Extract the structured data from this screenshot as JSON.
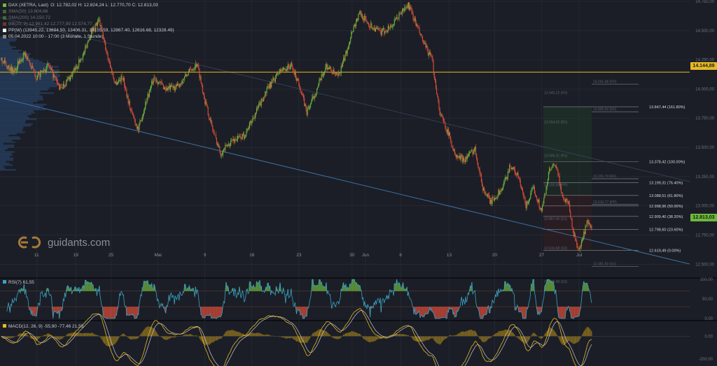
{
  "instrument": {
    "title": "DAX (XETRA, Last)",
    "ohlc": "O: 12.782,02  H: 12.824,24  L: 12.770,70  C: 12.813,03"
  },
  "indicators": [
    {
      "label": "SMA(50)  13.604,66",
      "color": "#6fb83f",
      "dim": true
    },
    {
      "label": "SMA(200)  14.150,72",
      "color": "#6fb83f",
      "dim": true
    },
    {
      "label": "BB(20, 2)  12.981,42  12.777,99  12.574,77",
      "color": "#e04e3b",
      "dim": true
    },
    {
      "label": "PP(W)  (13945.22, 13694.50, 13406.31, 13155.59, 12867.40, 12616.68, 12328.49)",
      "color": "#ffffff",
      "dim": false
    },
    {
      "label": "05.04.2022 10:00 - 17:00   (3 Monate, 1 Stunde)",
      "color": "#888888",
      "dim": false
    }
  ],
  "brand": {
    "name": "guidants.com"
  },
  "colors": {
    "up": "#6fb83f",
    "down": "#e04e3b",
    "hline": "#e8b923",
    "trend": "#3d6fa5",
    "rsi": "#3aa3c6",
    "macd": "#e8b923",
    "signal": "#c9ccd3"
  },
  "chart_data": [
    {
      "type": "candlestick",
      "ylim": [
        12400,
        14750
      ],
      "y_ticks": [
        "14.750,00",
        "14.500,00",
        "14.250,00",
        "14.000,00",
        "13.750,00",
        "13.500,00",
        "13.250,00",
        "13.000,00",
        "12.750,00",
        "12.500,00"
      ],
      "y_tick_values": [
        14750,
        14500,
        14250,
        14000,
        13750,
        13500,
        13250,
        13000,
        12750,
        12500
      ],
      "x_ticks": [
        "11",
        "19",
        "25",
        "Mai",
        "9",
        "16",
        "23",
        "30",
        "Jun",
        "6",
        "13",
        "20",
        "27",
        "Jul"
      ],
      "x_tick_index": [
        45,
        95,
        140,
        200,
        260,
        320,
        380,
        448,
        465,
        510,
        572,
        630,
        690,
        738
      ],
      "n_bars": 755,
      "last_price": "12.813,03",
      "last_price_value": 12813,
      "horizontal_line": {
        "label": "14.144,89",
        "value": 14144.89
      },
      "path": [
        [
          0,
          14250
        ],
        [
          15,
          14150
        ],
        [
          30,
          14300
        ],
        [
          45,
          14100
        ],
        [
          60,
          14200
        ],
        [
          75,
          14000
        ],
        [
          90,
          14120
        ],
        [
          105,
          14300
        ],
        [
          115,
          14500
        ],
        [
          125,
          14580
        ],
        [
          135,
          14300
        ],
        [
          145,
          14050
        ],
        [
          155,
          14100
        ],
        [
          165,
          13820
        ],
        [
          175,
          13650
        ],
        [
          185,
          13900
        ],
        [
          195,
          14100
        ],
        [
          210,
          14000
        ],
        [
          225,
          14020
        ],
        [
          240,
          14150
        ],
        [
          250,
          14220
        ],
        [
          260,
          13900
        ],
        [
          270,
          13650
        ],
        [
          280,
          13450
        ],
        [
          295,
          13560
        ],
        [
          310,
          13600
        ],
        [
          325,
          13800
        ],
        [
          340,
          14000
        ],
        [
          355,
          14150
        ],
        [
          370,
          14200
        ],
        [
          380,
          14050
        ],
        [
          390,
          13800
        ],
        [
          400,
          13950
        ],
        [
          415,
          14200
        ],
        [
          430,
          14100
        ],
        [
          440,
          14300
        ],
        [
          448,
          14500
        ],
        [
          458,
          14650
        ],
        [
          470,
          14550
        ],
        [
          485,
          14480
        ],
        [
          500,
          14550
        ],
        [
          510,
          14650
        ],
        [
          520,
          14720
        ],
        [
          530,
          14550
        ],
        [
          540,
          14380
        ],
        [
          550,
          14250
        ],
        [
          560,
          13800
        ],
        [
          572,
          13600
        ],
        [
          580,
          13420
        ],
        [
          592,
          13400
        ],
        [
          605,
          13490
        ],
        [
          615,
          13150
        ],
        [
          625,
          13030
        ],
        [
          640,
          13150
        ],
        [
          650,
          13350
        ],
        [
          660,
          13250
        ],
        [
          670,
          13000
        ],
        [
          680,
          13150
        ],
        [
          690,
          12950
        ],
        [
          700,
          13300
        ],
        [
          708,
          13350
        ],
        [
          718,
          13050
        ],
        [
          724,
          13050
        ],
        [
          730,
          12780
        ],
        [
          738,
          12620
        ],
        [
          742,
          12700
        ],
        [
          748,
          12850
        ],
        [
          753,
          12813
        ]
      ],
      "fibonacci": [
        {
          "price": "13.847,44",
          "pct": "(161.80%)",
          "value": 13847.44
        },
        {
          "price": "13.378,42",
          "pct": "(100.00%)",
          "value": 13378.42
        },
        {
          "price": "13.199,31",
          "pct": "(76.40%)",
          "value": 13199.31
        },
        {
          "price": "13.088,51",
          "pct": "(61.80%)",
          "value": 13088.51
        },
        {
          "price": "12.998,96",
          "pct": "(50.00%)",
          "value": 12998.96
        },
        {
          "price": "12.909,40",
          "pct": "(38.20%)",
          "value": 12909.4
        },
        {
          "price": "12.798,60",
          "pct": "(23.60%)",
          "value": 12798.6
        },
        {
          "price": "12.619,49",
          "pct": "(0.00%)",
          "value": 12619.49
        }
      ],
      "pivot_labels": [
        "13.945,22 (R3)",
        "13.694,50 (R2)",
        "13.406,31 (R1)",
        "13.155,59 (PP)",
        "12.867,40 (S1)",
        "12.616,68 (S2)",
        "12.328,49 (S3)"
      ],
      "pivot_values": [
        13945.22,
        13694.5,
        13406.31,
        13155.59,
        12867.4,
        12616.68,
        12328.49
      ],
      "pivot_labels_right": [
        "14.041,48 (R3)",
        "13.805,00 (R2)",
        "13.231,74 (R1)",
        "13.010,77 (PP)",
        "12.481,50 (S1)"
      ],
      "pivot_values_right": [
        14041.48,
        13805.0,
        13231.74,
        13010.77,
        12481.5
      ]
    },
    {
      "type": "line",
      "name": "RSI",
      "label": "RSI(7)  61,55",
      "ylim": [
        0,
        100
      ],
      "y_ticks": [
        "100,00",
        "50,00",
        "0,00"
      ],
      "y_tick_values": [
        100,
        50,
        0
      ],
      "last": 61.55
    },
    {
      "type": "bar+line",
      "name": "MACD",
      "label": "MACD(12, 26, 9)  -55,90  -77,46  21,55",
      "ylim": [
        -250,
        120
      ],
      "y_ticks": [
        "0,00",
        "-200,00"
      ],
      "y_tick_values": [
        0,
        -200
      ]
    }
  ]
}
